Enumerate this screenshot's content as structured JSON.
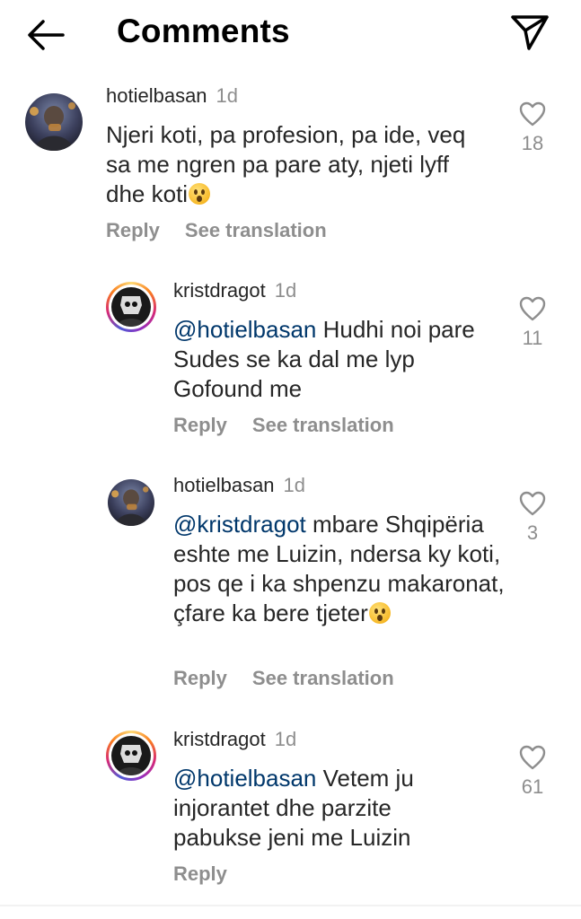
{
  "header": {
    "title": "Comments",
    "back_icon": "arrow-left-icon",
    "share_icon": "paper-plane-icon"
  },
  "comments": [
    {
      "username": "hotielbasan",
      "time": "1d",
      "text": "Njeri koti, pa profesion, pa ide, veq sa me ngren pa pare aty, njeti lyff dhe koti",
      "emoji": "😯",
      "reply_label": "Reply",
      "translation_label": "See translation",
      "likes": "18"
    },
    {
      "username": "kristdragot",
      "time": "1d",
      "mention": "@hotielbasan",
      "text": " Hudhi noi pare Sudes se ka dal me lyp Gofound me",
      "reply_label": "Reply",
      "translation_label": "See translation",
      "likes": "11"
    },
    {
      "username": "hotielbasan",
      "time": "1d",
      "mention": "@kristdragot",
      "text": " mbare Shqipëria eshte me Luizin, ndersa ky koti, pos qe i ka shpenzu makaronat, çfare ka bere tjeter",
      "emoji": "😯",
      "reply_label": "Reply",
      "translation_label": "See translation",
      "likes": "3"
    },
    {
      "username": "kristdragot",
      "time": "1d",
      "mention": "@hotielbasan",
      "text": " Vetem ju injorantet dhe parzite pabukse jeni me Luizin",
      "reply_label": "Reply",
      "likes": "61"
    }
  ],
  "colors": {
    "text": "#262626",
    "secondary": "#8e8e8e",
    "mention": "#00376b",
    "story_ring": [
      "#feda75",
      "#fa7e1e",
      "#d62976",
      "#962fbf",
      "#4f5bd5"
    ]
  }
}
